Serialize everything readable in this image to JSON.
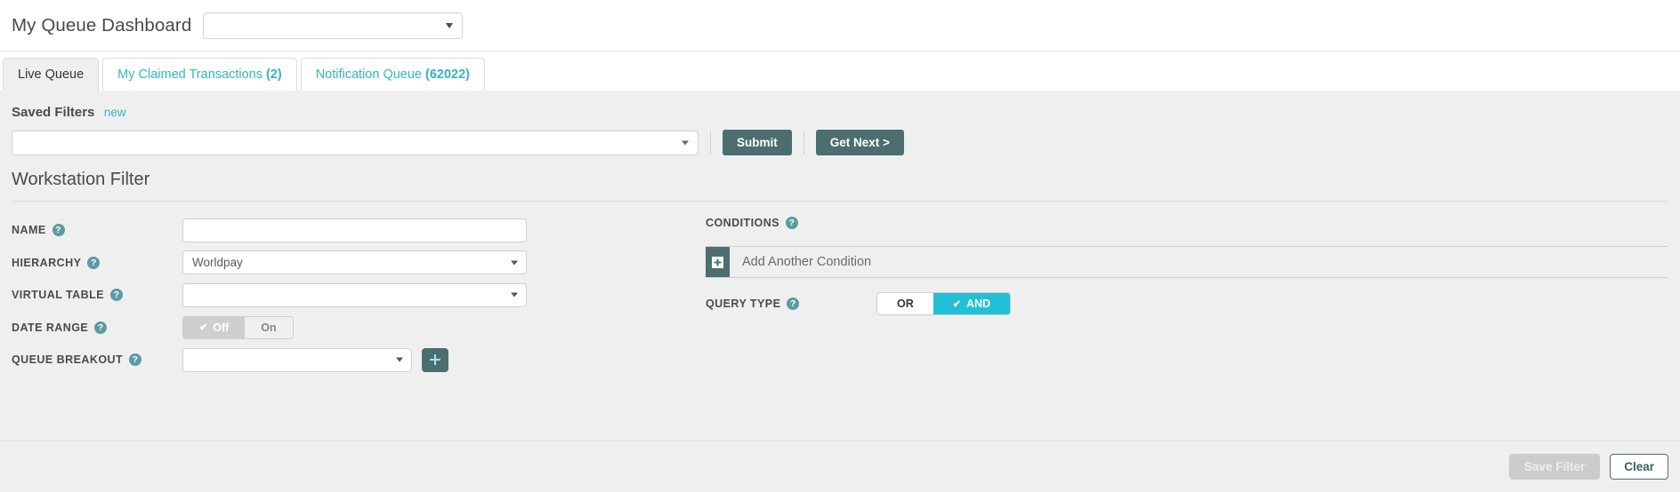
{
  "header": {
    "title": "My Queue Dashboard",
    "dashboard_select_value": "",
    "dashboard_select_icon": "chevron-down-icon"
  },
  "tabs": [
    {
      "label": "Live Queue",
      "count": "",
      "active": true
    },
    {
      "label": "My Claimed Transactions",
      "count": "(2)",
      "active": false
    },
    {
      "label": "Notification Queue",
      "count": "(62022)",
      "active": false
    }
  ],
  "saved_filters": {
    "label": "Saved Filters",
    "new_link": "new",
    "select_value": "",
    "submit_label": "Submit",
    "get_next_label": "Get Next >"
  },
  "filter_section": {
    "title": "Workstation Filter",
    "help_glyph": "?",
    "fields": {
      "name": {
        "label": "NAME",
        "value": ""
      },
      "hierarchy": {
        "label": "HIERARCHY",
        "value": "Worldpay"
      },
      "virtual_table": {
        "label": "VIRTUAL TABLE",
        "value": ""
      },
      "date_range": {
        "label": "DATE RANGE",
        "off_label": "Off",
        "on_label": "On",
        "selected": "Off",
        "check_glyph": "✔"
      },
      "queue_breakout": {
        "label": "QUEUE BREAKOUT",
        "value": "",
        "add_icon": "plus-icon"
      }
    }
  },
  "conditions": {
    "label": "CONDITIONS",
    "add_another_label": "Add Another Condition",
    "add_icon": "plus-box-icon",
    "query_type": {
      "label": "QUERY TYPE",
      "or_label": "OR",
      "and_label": "AND",
      "selected": "AND",
      "check_glyph": "✔"
    }
  },
  "footer": {
    "save_filter_label": "Save Filter",
    "clear_label": "Clear"
  },
  "colors": {
    "accent_teal": "#34b4c6",
    "button_slate": "#4c6e6e",
    "selected_cyan": "#21c0d7",
    "help_icon": "#5d9aa4",
    "panel_bg": "#f0efef"
  }
}
